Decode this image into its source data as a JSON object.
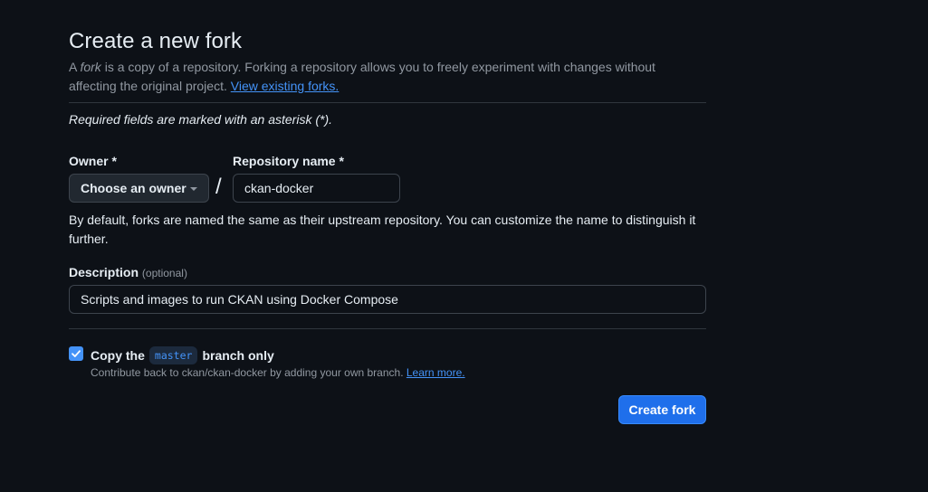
{
  "page": {
    "title": "Create a new fork",
    "intro": {
      "prefix": "A ",
      "fork_word": "fork",
      "text": " is a copy of a repository. Forking a repository allows you to freely experiment with changes without affecting the original project. ",
      "view_forks_link": "View existing forks."
    },
    "required_note": "Required fields are marked with an asterisk (*)."
  },
  "form": {
    "owner": {
      "label": "Owner *",
      "button_label": "Choose an owner",
      "icon": "triangle-down-icon"
    },
    "separator": "/",
    "repo_name": {
      "label": "Repository name *",
      "value": "ckan-docker"
    },
    "name_help": "By default, forks are named the same as their upstream repository. You can customize the name to distinguish it further.",
    "description": {
      "label": "Description",
      "optional_label": "(optional)",
      "value": "Scripts and images to run CKAN using Docker Compose"
    },
    "copy_branch": {
      "checked": true,
      "label_prefix": "Copy the",
      "branch": "master",
      "label_suffix": "branch only",
      "help_text": "Contribute back to ckan/ckan-docker by adding your own branch. ",
      "learn_more": "Learn more."
    },
    "submit_label": "Create fork"
  },
  "colors": {
    "background": "#0d1117",
    "primary_button": "#1f6feb",
    "link": "#4493f8",
    "border": "#3d444d"
  }
}
